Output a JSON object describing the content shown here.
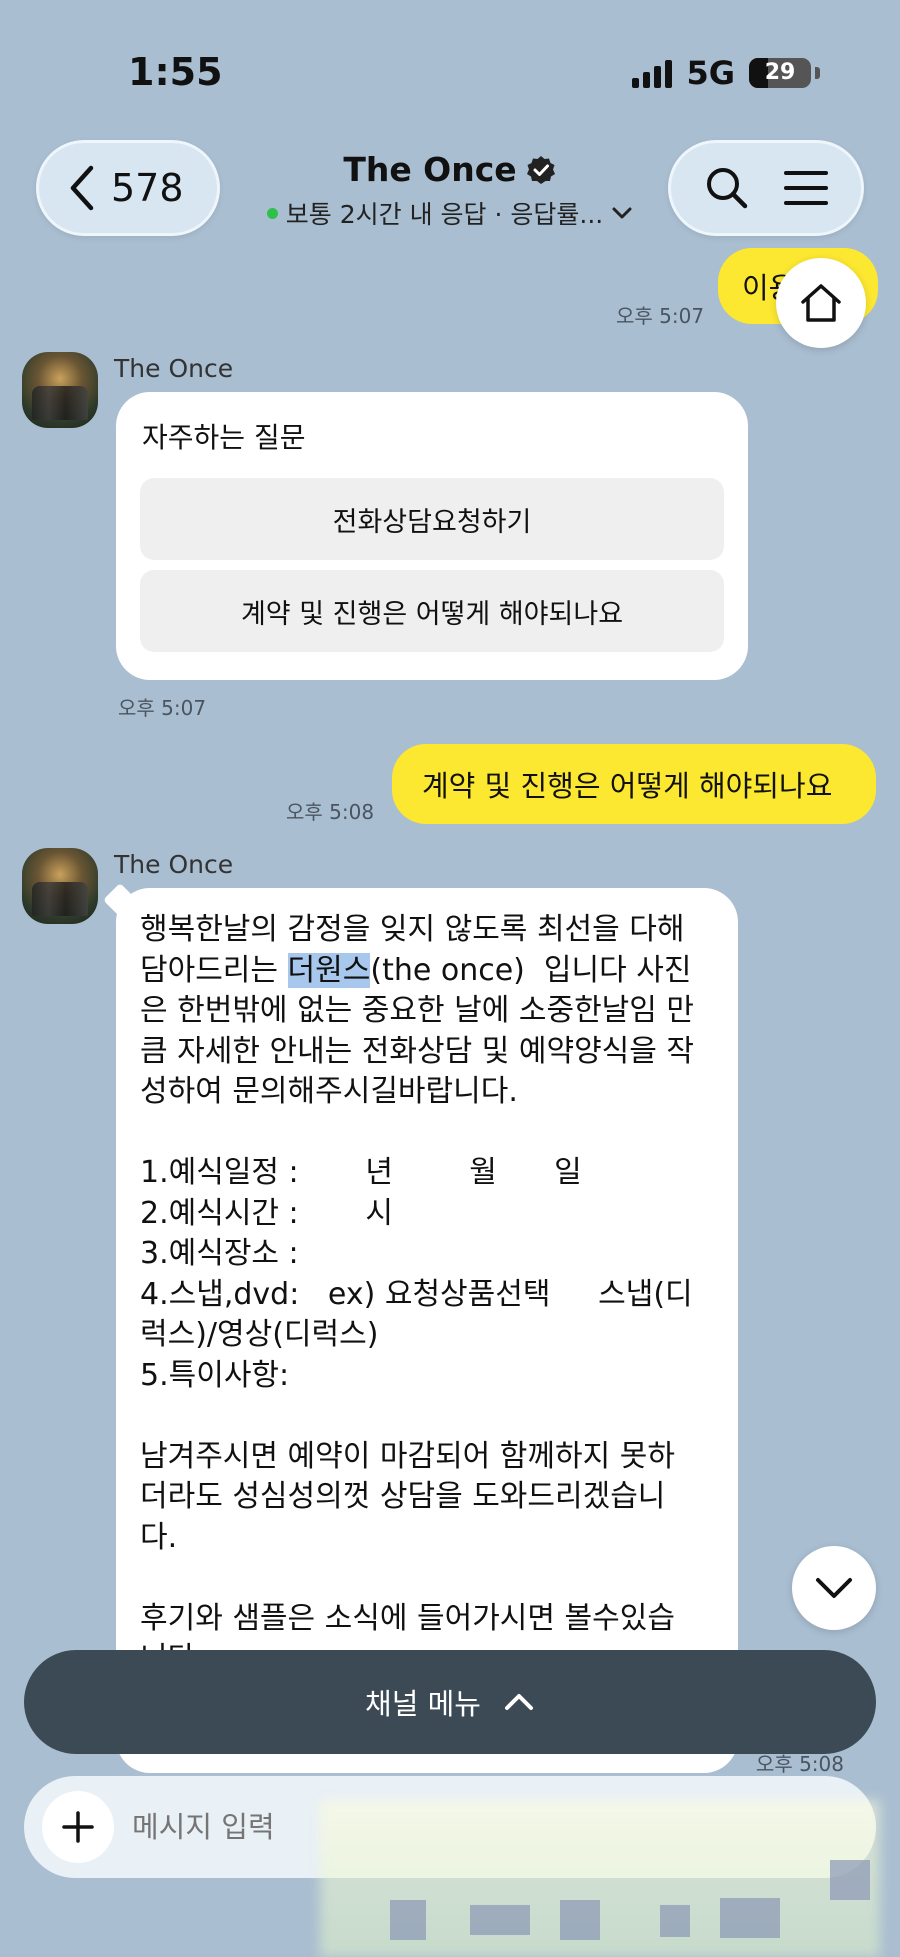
{
  "status_bar": {
    "time": "1:55",
    "network": "5G",
    "battery": "29"
  },
  "header": {
    "back_count": "578",
    "title": "The Once",
    "subtitle": "보통 2시간 내 응답 · 응답률..."
  },
  "messages": {
    "first_sent": {
      "text": "이용",
      "time": "오후 5:07"
    },
    "faq_card": {
      "sender": "The Once",
      "title": "자주하는 질문",
      "buttons": [
        "전화상담요청하기",
        "계약 및 진행은 어떻게 해야되나요"
      ],
      "time": "오후 5:07"
    },
    "second_sent": {
      "text": "계약 및 진행은 어떻게 해야되나요",
      "time": "오후 5:08"
    },
    "long_reply": {
      "sender": "The Once",
      "line1": "행복한날의 감정을 잊지 않도록 최선을 다해",
      "line2_pre": "담아드리는 ",
      "line2_hl": "더원스",
      "line2_post": "(the once)  입니다 사진",
      "line3": "은 한번밖에 없는 중요한 날에 소중한날임 만",
      "line4": "큼 자세한 안내는 전화상담 및 예약양식을 작",
      "line5": "성하여 문의해주시길바랍니다.",
      "line6": "",
      "line7": "1.예식일정 :       년        월      일",
      "line8": "2.예식시간 :       시",
      "line9": "3.예식장소 :",
      "line10": "4.스냅,dvd:   ex) 요청상품선택     스냅(디",
      "line11": "럭스)/영상(디럭스)",
      "line12": "5.특이사항:",
      "line13": "",
      "line14": "남겨주시면 예약이 마감되어 함께하지 못하",
      "line15": "더라도 성심성의껏 상담을 도와드리겠습니",
      "line16": "다.",
      "line17": "",
      "line18": "후기와 샘플은 소식에 들어가시면 볼수있습",
      "line19": "니다",
      "time": "오후 5:08"
    }
  },
  "channel_menu": {
    "label": "채널 메뉴"
  },
  "input": {
    "placeholder": "메시지 입력"
  }
}
